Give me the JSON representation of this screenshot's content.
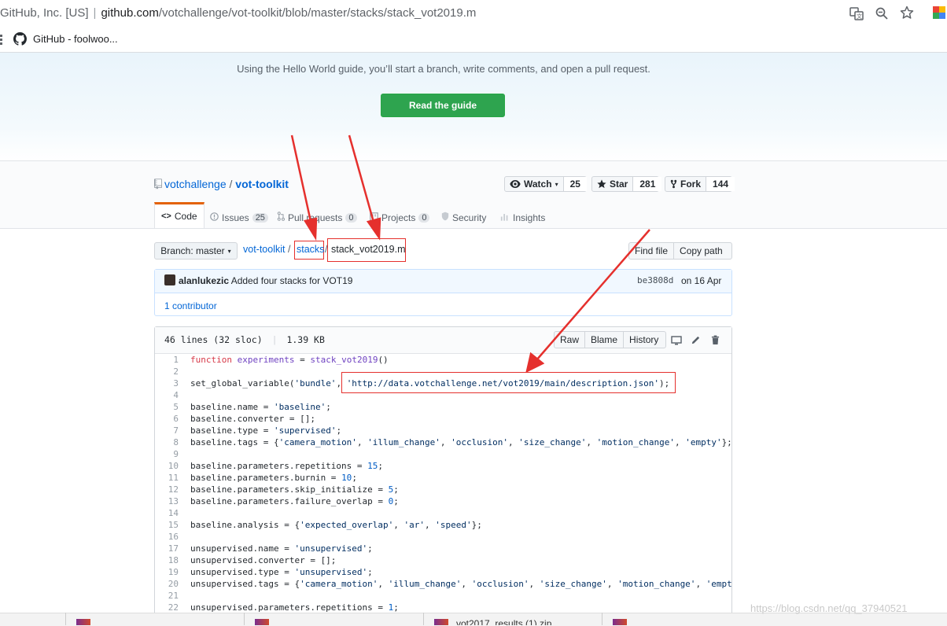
{
  "browser": {
    "site_identity": "GitHub, Inc. [US]",
    "url_host": "github.com",
    "url_path": "/votchallenge/vot-toolkit/blob/master/stacks/stack_vot2019.m",
    "bookmark_label": "GitHub - foolwoo..."
  },
  "banner": {
    "text": "Using the Hello World guide, you’ll start a branch, write comments, and open a pull request.",
    "button_label": "Read the guide",
    "accent": "#2ea44f"
  },
  "repo": {
    "owner": "votchallenge",
    "slash": "/",
    "name": "vot-toolkit",
    "watch_label": "Watch",
    "watch_count": "25",
    "star_label": "Star",
    "star_count": "281",
    "fork_label": "Fork",
    "fork_count": "144"
  },
  "tabs": [
    {
      "label": "Code",
      "icon": "code-icon"
    },
    {
      "label": "Issues",
      "count": "25",
      "icon": "issue-icon"
    },
    {
      "label": "Pull requests",
      "count": "0",
      "icon": "pull-request-icon"
    },
    {
      "label": "Projects",
      "count": "0",
      "icon": "project-icon"
    },
    {
      "label": "Security",
      "icon": "shield-icon"
    },
    {
      "label": "Insights",
      "icon": "graph-icon"
    }
  ],
  "filenav": {
    "branch_label": "Branch: master",
    "crumb_root": "vot-toolkit",
    "crumb_dir": "stacks",
    "crumb_file": "stack_vot2019.m",
    "find_file": "Find file",
    "copy_path": "Copy path"
  },
  "commit": {
    "author": "alanlukezic",
    "message": "Added four stacks for VOT19",
    "sha": "be3808d",
    "date": "on 16 Apr",
    "contributors": "1 contributor"
  },
  "file": {
    "lines_info": "46 lines (32 sloc)",
    "size": "1.39 KB",
    "raw": "Raw",
    "blame": "Blame",
    "history": "History"
  },
  "code_lines": [
    {
      "n": "1",
      "t": "function experiments = stack_vot2019()"
    },
    {
      "n": "2",
      "t": ""
    },
    {
      "n": "3",
      "t": "set_global_variable('bundle', 'http://data.votchallenge.net/vot2019/main/description.json');"
    },
    {
      "n": "4",
      "t": ""
    },
    {
      "n": "5",
      "t": "baseline.name = 'baseline';"
    },
    {
      "n": "6",
      "t": "baseline.converter = [];"
    },
    {
      "n": "7",
      "t": "baseline.type = 'supervised';"
    },
    {
      "n": "8",
      "t": "baseline.tags = {'camera_motion', 'illum_change', 'occlusion', 'size_change', 'motion_change', 'empty'};"
    },
    {
      "n": "9",
      "t": ""
    },
    {
      "n": "10",
      "t": "baseline.parameters.repetitions = 15;"
    },
    {
      "n": "11",
      "t": "baseline.parameters.burnin = 10;"
    },
    {
      "n": "12",
      "t": "baseline.parameters.skip_initialize = 5;"
    },
    {
      "n": "13",
      "t": "baseline.parameters.failure_overlap = 0;"
    },
    {
      "n": "14",
      "t": ""
    },
    {
      "n": "15",
      "t": "baseline.analysis = {'expected_overlap', 'ar', 'speed'};"
    },
    {
      "n": "16",
      "t": ""
    },
    {
      "n": "17",
      "t": "unsupervised.name = 'unsupervised';"
    },
    {
      "n": "18",
      "t": "unsupervised.converter = [];"
    },
    {
      "n": "19",
      "t": "unsupervised.type = 'unsupervised';"
    },
    {
      "n": "20",
      "t": "unsupervised.tags = {'camera_motion', 'illum_change', 'occlusion', 'size_change', 'motion_change', 'empty'};"
    },
    {
      "n": "21",
      "t": ""
    },
    {
      "n": "22",
      "t": "unsupervised.parameters.repetitions = 1;"
    }
  ],
  "taskbar": {
    "item_3": "vot2017_results (1).zip"
  },
  "watermark": "https://blog.csdn.net/qq_37940521",
  "annotation_color": "#e5302d"
}
